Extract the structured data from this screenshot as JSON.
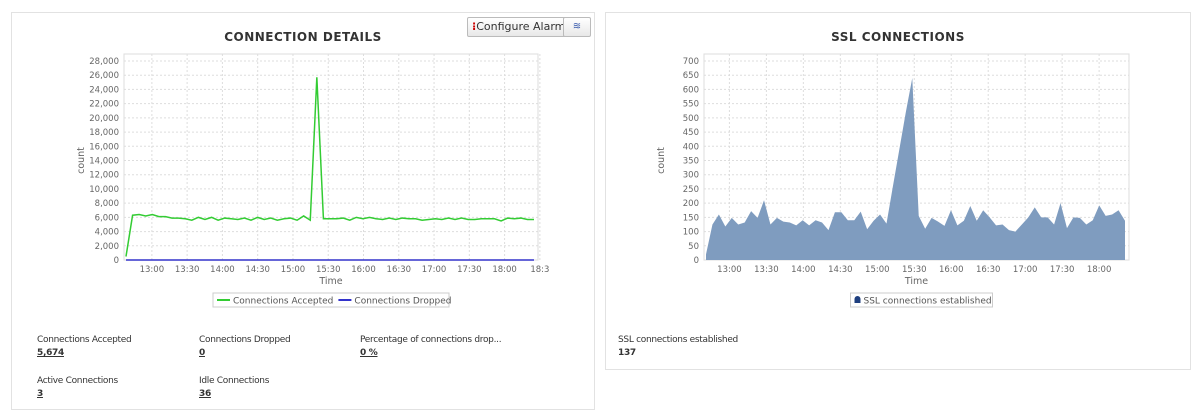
{
  "buttons": {
    "configure_alarms": "Configure Alarms",
    "chart_type": "chart-type-icon"
  },
  "stats": [
    {
      "label": "Connections Accepted",
      "value": "5,674"
    },
    {
      "label": "Connections Dropped",
      "value": "0"
    },
    {
      "label": "Percentage of connections drop...",
      "value": "0 %"
    },
    {
      "label": "Active Connections",
      "value": "3"
    },
    {
      "label": "Idle Connections",
      "value": "36"
    }
  ],
  "ssl_stats": [
    {
      "label": "SSL connections established",
      "value": "137"
    }
  ],
  "chart_data": [
    {
      "type": "line",
      "title": "CONNECTION DETAILS",
      "xlabel": "Time",
      "ylabel": "count",
      "ylim": [
        0,
        28000
      ],
      "yticks": [
        "0",
        "2,000",
        "4,000",
        "6,000",
        "8,000",
        "10,000",
        "12,000",
        "14,000",
        "16,000",
        "18,000",
        "20,000",
        "22,000",
        "24,000",
        "26,000",
        "28,000"
      ],
      "xticks": [
        "13:00",
        "13:30",
        "14:00",
        "14:30",
        "15:00",
        "15:30",
        "16:00",
        "16:30",
        "17:00",
        "17:30",
        "18:00",
        "18:3"
      ],
      "x_start": "12:38",
      "x_end": "18:25",
      "grid": true,
      "legend": "bottom",
      "series": [
        {
          "name": "Connections Accepted",
          "color": "#33cc33",
          "values": [
            500,
            6300,
            6400,
            6200,
            6400,
            6100,
            6100,
            5900,
            5900,
            5800,
            5600,
            6000,
            5700,
            6000,
            5600,
            5900,
            5800,
            5700,
            5900,
            5600,
            6000,
            5700,
            5900,
            5600,
            5800,
            5900,
            5600,
            6200,
            5600,
            25700,
            5800,
            5800,
            5800,
            5900,
            5600,
            6000,
            5800,
            6000,
            5800,
            5700,
            5900,
            5700,
            5900,
            5800,
            5800,
            5600,
            5700,
            5800,
            5700,
            5900,
            5700,
            5900,
            5700,
            5700,
            5800,
            5800,
            5800,
            5500,
            5900,
            5800,
            5900,
            5700,
            5700
          ]
        },
        {
          "name": "Connections Dropped",
          "color": "#3333cc",
          "values": [
            0,
            0,
            0,
            0,
            0,
            0,
            0,
            0,
            0,
            0,
            0,
            0,
            0,
            0,
            0,
            0,
            0,
            0,
            0,
            0,
            0,
            0,
            0,
            0,
            0,
            0,
            0,
            0,
            0,
            0,
            0,
            0,
            0,
            0,
            0,
            0,
            0,
            0,
            0,
            0,
            0,
            0,
            0,
            0,
            0,
            0,
            0,
            0,
            0,
            0,
            0,
            0,
            0,
            0,
            0,
            0,
            0,
            0,
            0,
            0,
            0,
            0,
            0
          ]
        }
      ]
    },
    {
      "type": "area",
      "title": "SSL CONNECTIONS",
      "xlabel": "Time",
      "ylabel": "count",
      "ylim": [
        0,
        700
      ],
      "yticks": [
        "0",
        "50",
        "100",
        "150",
        "200",
        "250",
        "300",
        "350",
        "400",
        "450",
        "500",
        "550",
        "600",
        "650",
        "700"
      ],
      "xticks": [
        "13:00",
        "13:30",
        "14:00",
        "14:30",
        "15:00",
        "15:30",
        "16:00",
        "16:30",
        "17:00",
        "17:30",
        "18:00"
      ],
      "x_start": "12:41",
      "x_end": "18:21",
      "grid": true,
      "legend": "bottom",
      "series": [
        {
          "name": "SSL connections established",
          "color": "#7f9cbf",
          "values": [
            20,
            125,
            160,
            118,
            148,
            125,
            132,
            172,
            148,
            210,
            125,
            148,
            135,
            132,
            122,
            140,
            122,
            140,
            132,
            105,
            168,
            168,
            140,
            140,
            170,
            108,
            138,
            160,
            128,
            260,
            390,
            520,
            640,
            155,
            110,
            148,
            135,
            120,
            175,
            122,
            138,
            190,
            138,
            175,
            150,
            122,
            125,
            105,
            100,
            125,
            150,
            185,
            150,
            150,
            125,
            200,
            112,
            150,
            148,
            125,
            140,
            192,
            155,
            160,
            175,
            138
          ]
        }
      ]
    }
  ]
}
